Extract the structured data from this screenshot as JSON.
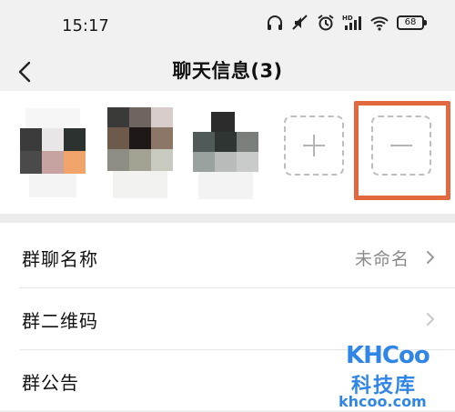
{
  "status_bar": {
    "time": "15:17",
    "battery": "68",
    "icons": [
      "headphones-icon",
      "mute-icon",
      "alarm-icon",
      "hd-signal-icon",
      "wifi-icon",
      "battery-icon"
    ]
  },
  "nav": {
    "title": "聊天信息(3)",
    "back_icon": "chevron-left-icon"
  },
  "members": {
    "avatars": [
      "member-avatar-1",
      "member-avatar-2",
      "member-avatar-3"
    ],
    "add_icon": "plus-icon",
    "remove_icon": "minus-icon",
    "highlight_color": "#e2683f"
  },
  "settings": {
    "rows": [
      {
        "label": "群聊名称",
        "value": "未命名"
      },
      {
        "label": "群二维码",
        "value": ""
      },
      {
        "label": "群公告",
        "value": ""
      }
    ]
  },
  "watermark": {
    "logo": "KHCoo",
    "name": "科技库",
    "url": "khcoo.com"
  }
}
